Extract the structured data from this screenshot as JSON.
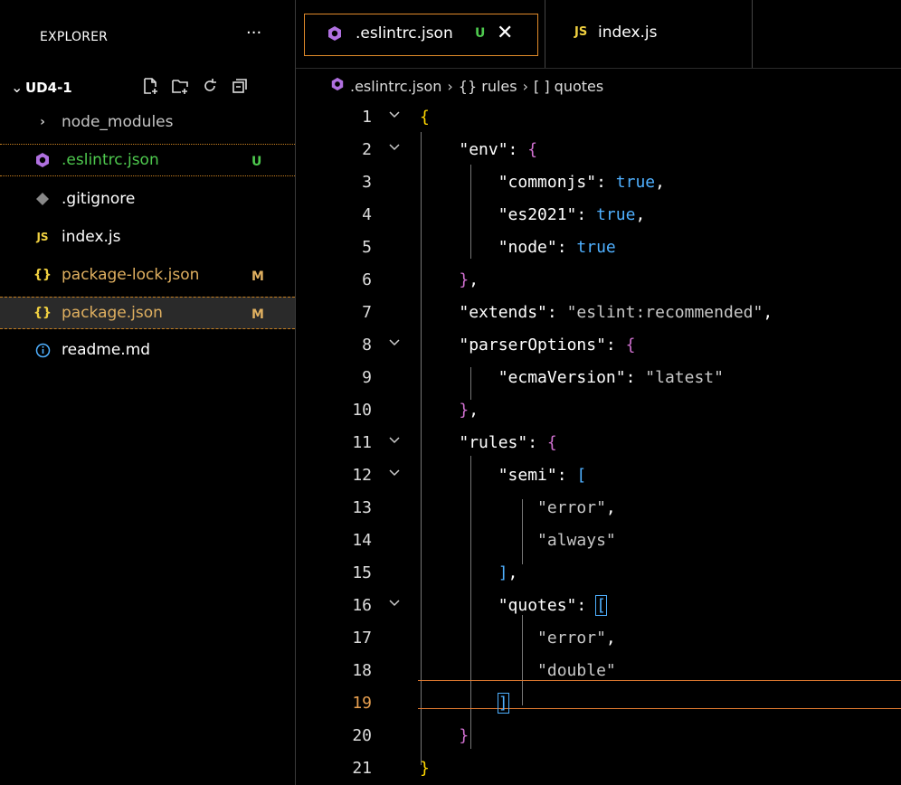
{
  "sidebar": {
    "header": "EXPLORER",
    "more": "···",
    "folder": "UD4-1",
    "items": [
      {
        "name": "node_modules",
        "badge": "",
        "icon": "chevron-right"
      },
      {
        "name": ".eslintrc.json",
        "badge": "U",
        "icon": "eslint"
      },
      {
        "name": ".gitignore",
        "badge": "",
        "icon": "git"
      },
      {
        "name": "index.js",
        "badge": "",
        "icon": "JS"
      },
      {
        "name": "package-lock.json",
        "badge": "M",
        "icon": "{}"
      },
      {
        "name": "package.json",
        "badge": "M",
        "icon": "{}"
      },
      {
        "name": "readme.md",
        "badge": "",
        "icon": "info"
      }
    ]
  },
  "tabs": [
    {
      "label": ".eslintrc.json",
      "badge": "U",
      "close": "✕"
    },
    {
      "label": "index.js",
      "icon": "JS"
    }
  ],
  "breadcrumb": {
    "file": ".eslintrc.json",
    "rules": "{} rules",
    "quotes": "[ ] quotes"
  },
  "editor": {
    "current_line": 19,
    "lines": [
      "1",
      "2",
      "3",
      "4",
      "5",
      "6",
      "7",
      "8",
      "9",
      "10",
      "11",
      "12",
      "13",
      "14",
      "15",
      "16",
      "17",
      "18",
      "19",
      "20",
      "21"
    ],
    "tokens": {
      "env": "\"env\"",
      "commonjs": "\"commonjs\"",
      "es2021": "\"es2021\"",
      "node": "\"node\"",
      "extends": "\"extends\"",
      "extends_val": "\"eslint:recommended\"",
      "parserOptions": "\"parserOptions\"",
      "ecmaVersion": "\"ecmaVersion\"",
      "ecmaVersion_val": "\"latest\"",
      "rules": "\"rules\"",
      "semi": "\"semi\"",
      "error": "\"error\"",
      "always": "\"always\"",
      "quotes": "\"quotes\"",
      "double": "\"double\"",
      "true": "true"
    }
  }
}
